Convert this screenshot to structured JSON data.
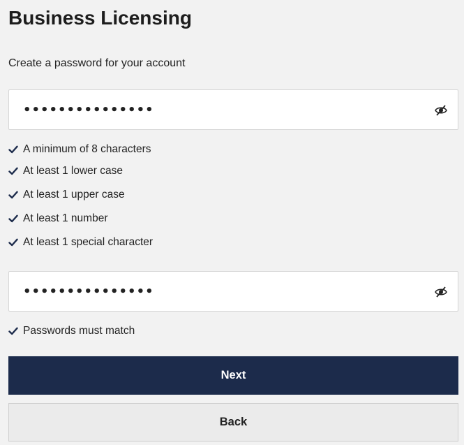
{
  "page": {
    "title": "Business Licensing",
    "subtitle": "Create a password for your account"
  },
  "password_field": {
    "value": "•••••••••••••••",
    "toggle_icon": "eye-slash-icon"
  },
  "password_rules": [
    {
      "label": "A minimum of 8 characters",
      "met": true
    },
    {
      "label": "At least 1 lower case",
      "met": true
    },
    {
      "label": "At least 1 upper case",
      "met": true
    },
    {
      "label": "At least 1 number",
      "met": true
    },
    {
      "label": "At least 1 special character",
      "met": true
    }
  ],
  "confirm_field": {
    "value": "•••••••••••••••",
    "toggle_icon": "eye-slash-icon"
  },
  "confirm_rules": [
    {
      "label": "Passwords must match",
      "met": true
    }
  ],
  "buttons": {
    "next_label": "Next",
    "back_label": "Back"
  },
  "colors": {
    "primary_button": "#1c2b4b",
    "secondary_button": "#ebebeb",
    "check": "#1c2b4b",
    "background": "#f2f2f2"
  }
}
